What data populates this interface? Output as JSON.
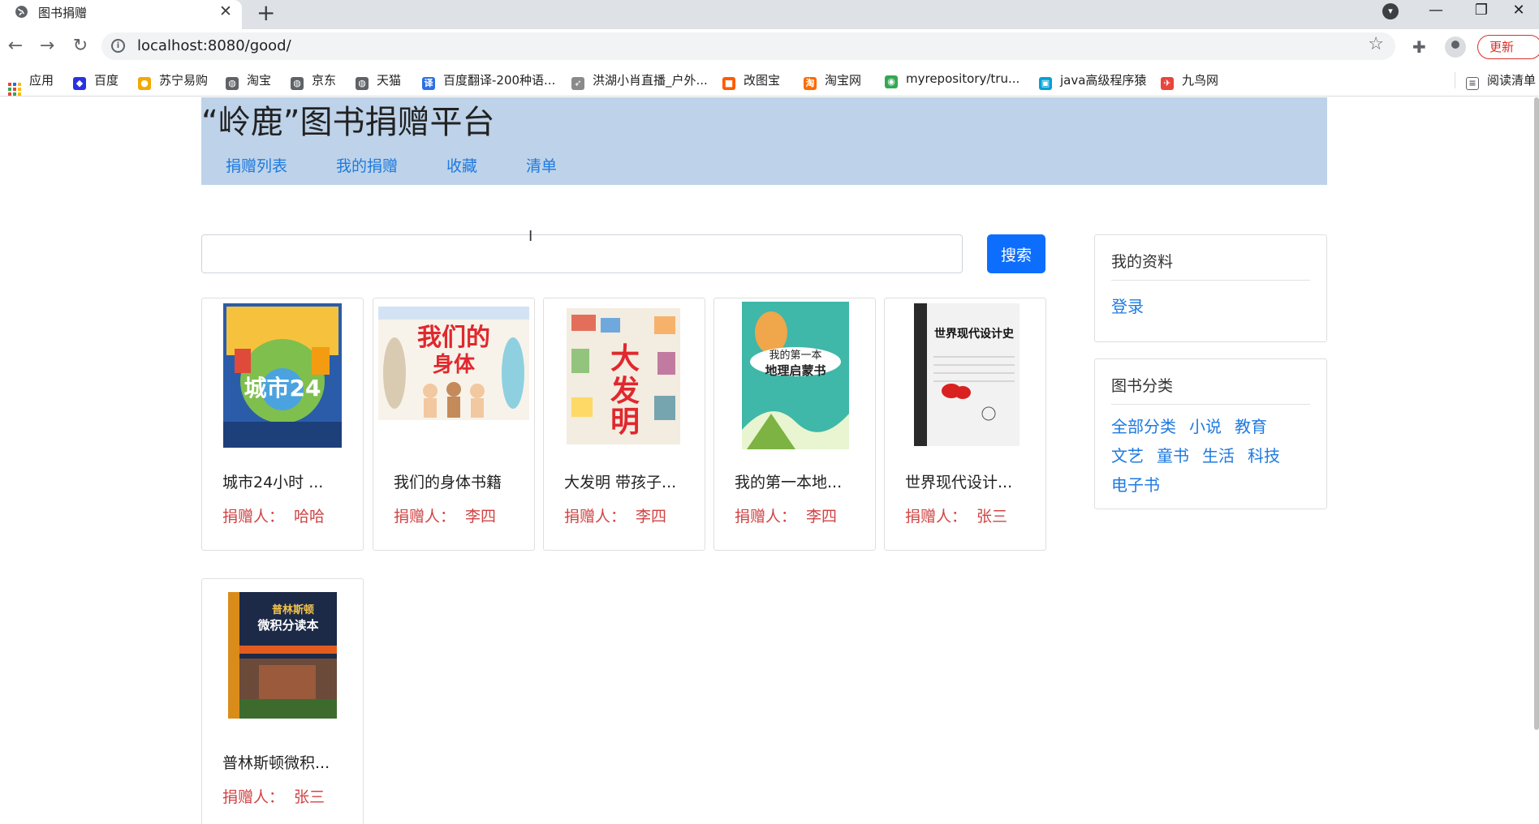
{
  "browser": {
    "tab_title": "图书捐赠",
    "url": "localhost:8080/good/",
    "update_label": "更新",
    "bookmarks": [
      {
        "label": "应用",
        "icon": "apps-grid-icon",
        "color": "#e8453c"
      },
      {
        "label": "百度",
        "icon": "baidu-icon",
        "color": "#2932e1"
      },
      {
        "label": "苏宁易购",
        "icon": "suning-icon",
        "color": "#f2a900"
      },
      {
        "label": "淘宝",
        "icon": "globe-icon",
        "color": "#5f6368"
      },
      {
        "label": "京东",
        "icon": "globe-icon",
        "color": "#5f6368"
      },
      {
        "label": "天猫",
        "icon": "globe-icon",
        "color": "#5f6368"
      },
      {
        "label": "百度翻译-200种语...",
        "icon": "translate-icon",
        "color": "#2f6fe4"
      },
      {
        "label": "洪湖小肖直播_户外...",
        "icon": "feather-icon",
        "color": "#8a8a8a"
      },
      {
        "label": "改图宝",
        "icon": "gaitubao-icon",
        "color": "#ff5a00"
      },
      {
        "label": "淘宝网",
        "icon": "taobao-icon",
        "color": "#ff6a00"
      },
      {
        "label": "myrepository/tru...",
        "icon": "chrome-icon",
        "color": "#34a853"
      },
      {
        "label": "java高级程序猿",
        "icon": "bilibili-icon",
        "color": "#00a1d6"
      },
      {
        "label": "九鸟网",
        "icon": "bird-icon",
        "color": "#e8453c"
      }
    ],
    "reading_list": "阅读清单"
  },
  "site": {
    "title": "“岭鹿”图书捐赠平台",
    "nav": [
      "捐赠列表",
      "我的捐赠",
      "收藏",
      "清单"
    ],
    "header_color": "#bed3e9"
  },
  "search": {
    "value": "",
    "button_label": "搜索"
  },
  "books": [
    {
      "title": "城市24小时 ...",
      "donor_label": "捐赠人：",
      "donor": "哈哈",
      "cover_text": "城市24小时"
    },
    {
      "title": "我们的身体书籍",
      "donor_label": "捐赠人：",
      "donor": "李四",
      "cover_text": "我们的身体"
    },
    {
      "title": "大发明 带孩子...",
      "donor_label": "捐赠人：",
      "donor": "李四",
      "cover_text": "大发明"
    },
    {
      "title": "我的第一本地...",
      "donor_label": "捐赠人：",
      "donor": "李四",
      "cover_text": "我的第一本地理启蒙书"
    },
    {
      "title": "世界现代设计...",
      "donor_label": "捐赠人：",
      "donor": "张三",
      "cover_text": "世界现代设计史"
    },
    {
      "title": "普林斯顿微积...",
      "donor_label": "捐赠人：",
      "donor": "张三",
      "cover_text": "普林斯顿微积分读本"
    }
  ],
  "profile_panel": {
    "title": "我的资料",
    "login_label": "登录"
  },
  "category_panel": {
    "title": "图书分类",
    "categories": [
      "全部分类",
      "小说",
      "教育",
      "文艺",
      "童书",
      "生活",
      "科技",
      "电子书"
    ]
  }
}
